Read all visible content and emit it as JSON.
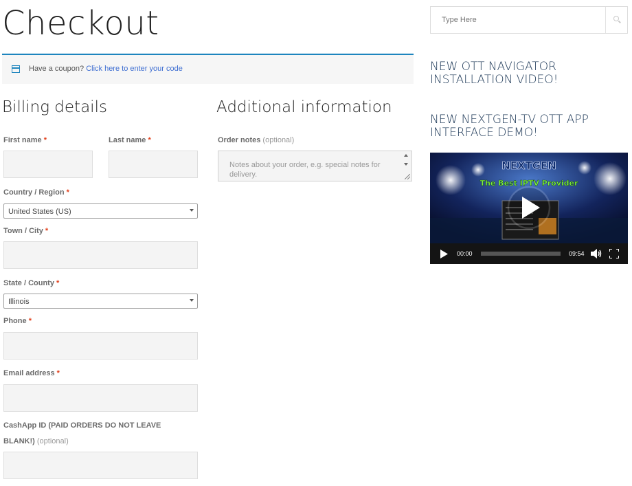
{
  "page": {
    "title": "Checkout"
  },
  "coupon": {
    "text": "Have a coupon?",
    "link": "Click here to enter your code"
  },
  "billing": {
    "heading": "Billing details",
    "required_mark": "*",
    "optional_text": "(optional)",
    "first_name_label": "First name",
    "last_name_label": "Last name",
    "country_label": "Country / Region",
    "country_value": "United States (US)",
    "city_label": "Town / City",
    "state_label": "State / County",
    "state_value": "Illinois",
    "phone_label": "Phone",
    "email_label": "Email address",
    "cashapp_label_line1": "CashApp ID (PAID ORDERS DO NOT LEAVE",
    "cashapp_label_line2": "BLANK!)"
  },
  "additional": {
    "heading": "Additional information",
    "notes_label": "Order notes",
    "optional_text": "(optional)",
    "notes_placeholder": "Notes about your order, e.g. special notes for delivery."
  },
  "sidebar": {
    "search_placeholder": "Type Here",
    "link1": "NEW OTT NAVIGATOR INSTALLATION VIDEO!",
    "link2": "NEW NEXTGEN-TV OTT APP INTERFACE DEMO!"
  },
  "video": {
    "brand": "NEXTGEN",
    "tagline": "The Best IPTV Provider",
    "current_time": "00:00",
    "duration": "09:54",
    "progress": 0
  },
  "colors": {
    "accent": "#1e85be",
    "link": "#3d6dd1",
    "required": "#e2401c",
    "sidebar_heading": "#1d3857"
  },
  "icons": [
    "calendar-icon",
    "search-icon",
    "play-icon",
    "volume-icon",
    "fullscreen-icon"
  ]
}
